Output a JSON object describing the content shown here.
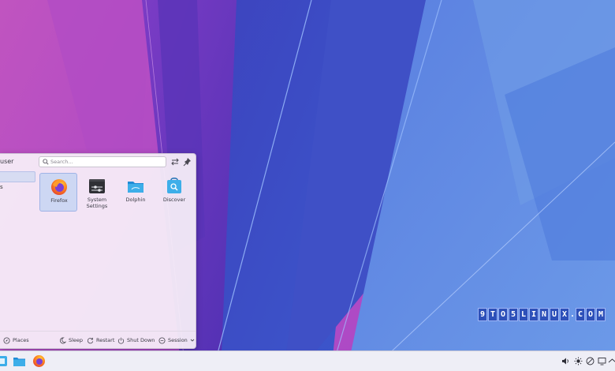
{
  "launcher": {
    "user_name": "user",
    "search": {
      "placeholder": "Search...",
      "value": ""
    },
    "header_icons": [
      "switch-direction-icon",
      "pin-icon"
    ],
    "sidebar": {
      "items": [
        {
          "label": "",
          "selected": true
        },
        {
          "label": "s",
          "selected": false
        }
      ]
    },
    "apps": [
      {
        "name_line1": "Firefox",
        "name_line2": "",
        "icon": "firefox-icon",
        "selected": true
      },
      {
        "name_line1": "System",
        "name_line2": "Settings",
        "icon": "system-settings-icon",
        "selected": false
      },
      {
        "name_line1": "Dolphin",
        "name_line2": "",
        "icon": "dolphin-folder-icon",
        "selected": false
      },
      {
        "name_line1": "Discover",
        "name_line2": "",
        "icon": "discover-icon",
        "selected": false
      }
    ],
    "footer": {
      "places_label": "Places",
      "sleep_label": "Sleep",
      "restart_label": "Restart",
      "shutdown_label": "Shut Down",
      "session_label": "Session"
    }
  },
  "watermark": {
    "chars": [
      "9",
      "T",
      "O",
      "5",
      "L",
      "I",
      "N",
      "U",
      "X",
      ".",
      "C",
      "O",
      "M"
    ]
  },
  "taskbar": {
    "pinned": [
      "application-launcher-icon",
      "dolphin-folder-icon",
      "firefox-icon"
    ],
    "tray": [
      "volume-icon",
      "brightness-icon",
      "network-icon",
      "display-icon",
      "chevron-up-icon"
    ]
  },
  "colors": {
    "launcher_bg": "#f6eef8",
    "selection": "#cdd7f3",
    "taskbar_bg": "#eeeef6",
    "watermark_bg": "#2d50b9"
  }
}
